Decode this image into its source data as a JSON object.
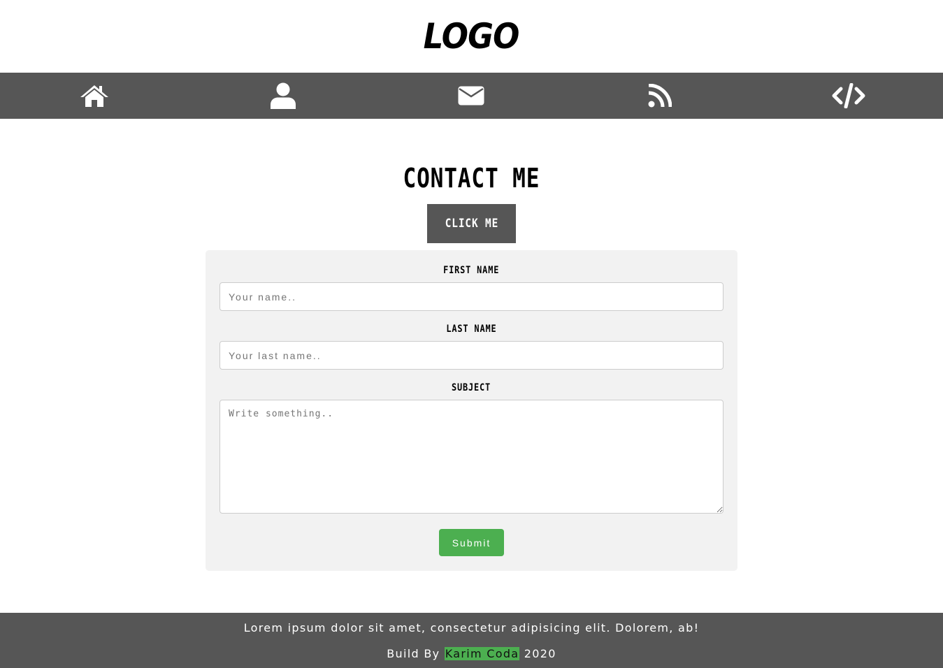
{
  "header": {
    "logo": "LOGO"
  },
  "nav": {
    "items": [
      {
        "icon": "home-icon"
      },
      {
        "icon": "user-icon"
      },
      {
        "icon": "envelope-icon"
      },
      {
        "icon": "rss-icon"
      },
      {
        "icon": "code-icon"
      }
    ],
    "background": "#565656"
  },
  "main": {
    "title": "CONTACT ME",
    "click_button": "CLICK ME",
    "form": {
      "first_name_label": "FIRST NAME",
      "first_name_placeholder": "Your name..",
      "last_name_label": "LAST NAME",
      "last_name_placeholder": "Your last name..",
      "subject_label": "SUBJECT",
      "subject_placeholder": "Write something..",
      "submit_label": "Submit"
    },
    "accent": "#4caf50"
  },
  "footer": {
    "text": "Lorem ipsum dolor sit amet, consectetur adipisicing elit. Dolorem, ab!",
    "build_prefix": "Build By",
    "author": "Karim Coda",
    "year": "2020"
  }
}
